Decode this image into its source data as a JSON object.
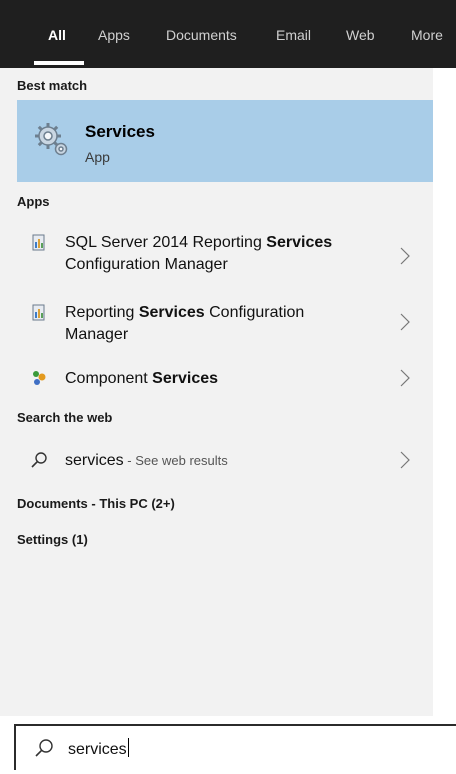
{
  "tabs": [
    {
      "label": "All",
      "active": true
    },
    {
      "label": "Apps",
      "active": false
    },
    {
      "label": "Documents",
      "active": false
    },
    {
      "label": "Email",
      "active": false
    },
    {
      "label": "Web",
      "active": false
    },
    {
      "label": "More",
      "active": false
    }
  ],
  "sections": {
    "best_match": "Best match",
    "apps": "Apps",
    "search_web": "Search the web",
    "documents": "Documents - This PC (2+)",
    "settings": "Settings (1)"
  },
  "best_match": {
    "title": "Services",
    "subtitle": "App",
    "icon": "services-gear-icon"
  },
  "apps": [
    {
      "line1_prefix": "SQL Server 2014 Reporting ",
      "line1_bold": "Services",
      "line2": "Configuration Manager",
      "icon": "report-manager-icon"
    },
    {
      "line1_prefix": "Reporting ",
      "line1_bold": "Services",
      "line1_suffix": " Configuration",
      "line2": "Manager",
      "icon": "report-manager-icon"
    },
    {
      "line1_prefix": "Component ",
      "line1_bold": "Services",
      "icon": "component-services-icon"
    }
  ],
  "web": {
    "query": "services",
    "hint": " - See web results",
    "icon": "search-icon"
  },
  "search": {
    "value": "services",
    "icon": "search-icon"
  },
  "colors": {
    "highlight": "#a9cde8",
    "tabbar": "#1f1f1f",
    "panel": "#f2f2f2"
  }
}
